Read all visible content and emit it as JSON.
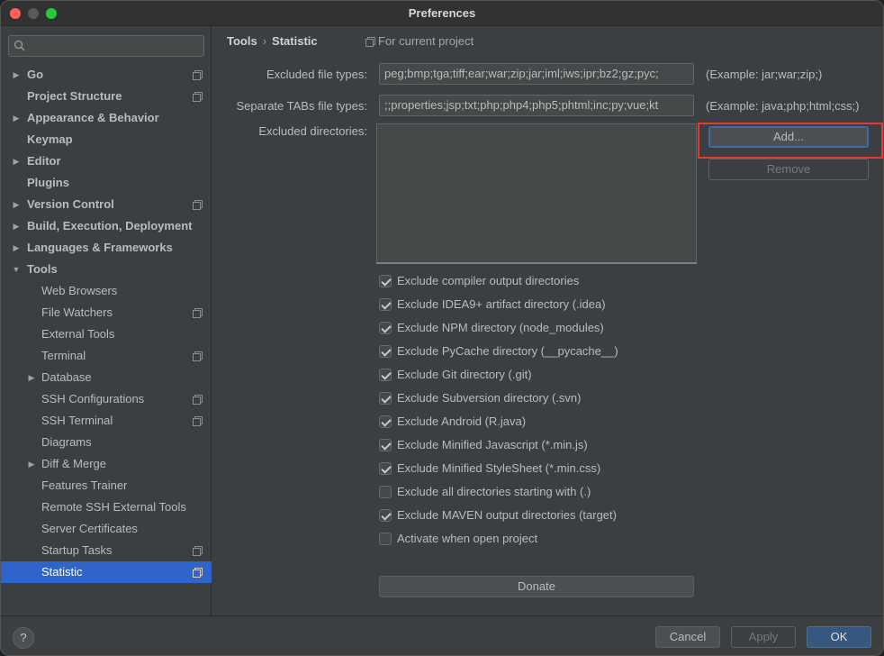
{
  "window": {
    "title": "Preferences"
  },
  "search": {
    "placeholder": ""
  },
  "sidebar": {
    "items": [
      {
        "label": "Go",
        "level": 0,
        "arrow": "right",
        "proj": true
      },
      {
        "label": "Project Structure",
        "level": 0,
        "arrow": "",
        "proj": true
      },
      {
        "label": "Appearance & Behavior",
        "level": 0,
        "arrow": "right",
        "proj": false
      },
      {
        "label": "Keymap",
        "level": 0,
        "arrow": "",
        "proj": false
      },
      {
        "label": "Editor",
        "level": 0,
        "arrow": "right",
        "proj": false
      },
      {
        "label": "Plugins",
        "level": 0,
        "arrow": "",
        "proj": false
      },
      {
        "label": "Version Control",
        "level": 0,
        "arrow": "right",
        "proj": true
      },
      {
        "label": "Build, Execution, Deployment",
        "level": 0,
        "arrow": "right",
        "proj": false
      },
      {
        "label": "Languages & Frameworks",
        "level": 0,
        "arrow": "right",
        "proj": false
      },
      {
        "label": "Tools",
        "level": 0,
        "arrow": "down",
        "proj": false
      },
      {
        "label": "Web Browsers",
        "level": 1,
        "arrow": "",
        "proj": false
      },
      {
        "label": "File Watchers",
        "level": 1,
        "arrow": "",
        "proj": true
      },
      {
        "label": "External Tools",
        "level": 1,
        "arrow": "",
        "proj": false
      },
      {
        "label": "Terminal",
        "level": 1,
        "arrow": "",
        "proj": true
      },
      {
        "label": "Database",
        "level": 1,
        "arrow": "right",
        "proj": false
      },
      {
        "label": "SSH Configurations",
        "level": 1,
        "arrow": "",
        "proj": true
      },
      {
        "label": "SSH Terminal",
        "level": 1,
        "arrow": "",
        "proj": true
      },
      {
        "label": "Diagrams",
        "level": 1,
        "arrow": "",
        "proj": false
      },
      {
        "label": "Diff & Merge",
        "level": 1,
        "arrow": "right",
        "proj": false
      },
      {
        "label": "Features Trainer",
        "level": 1,
        "arrow": "",
        "proj": false
      },
      {
        "label": "Remote SSH External Tools",
        "level": 1,
        "arrow": "",
        "proj": false
      },
      {
        "label": "Server Certificates",
        "level": 1,
        "arrow": "",
        "proj": false
      },
      {
        "label": "Startup Tasks",
        "level": 1,
        "arrow": "",
        "proj": true
      },
      {
        "label": "Statistic",
        "level": 1,
        "arrow": "",
        "proj": true,
        "selected": true
      }
    ]
  },
  "breadcrumb": {
    "parent": "Tools",
    "separator": "›",
    "current": "Statistic"
  },
  "scope": {
    "label": "For current project"
  },
  "form": {
    "excluded_types_label": "Excluded file types:",
    "excluded_types_value": "peg;bmp;tga;tiff;ear;war;zip;jar;iml;iws;ipr;bz2;gz;pyc;",
    "excluded_types_example": "(Example: jar;war;zip;)",
    "tabs_types_label": "Separate TABs file types:",
    "tabs_types_value": ";;properties;jsp;txt;php;php4;php5;phtml;inc;py;vue;kt",
    "tabs_types_example": "(Example: java;php;html;css;)",
    "excluded_dirs_label": "Excluded directories:",
    "add_label": "Add...",
    "remove_label": "Remove"
  },
  "checks": [
    {
      "label": "Exclude compiler output directories",
      "checked": true
    },
    {
      "label": "Exclude IDEA9+ artifact directory (.idea)",
      "checked": true
    },
    {
      "label": "Exclude NPM directory (node_modules)",
      "checked": true
    },
    {
      "label": "Exclude PyCache directory (__pycache__)",
      "checked": true
    },
    {
      "label": "Exclude Git directory (.git)",
      "checked": true
    },
    {
      "label": "Exclude Subversion directory (.svn)",
      "checked": true
    },
    {
      "label": "Exclude Android (R.java)",
      "checked": true
    },
    {
      "label": "Exclude Minified Javascript (*.min.js)",
      "checked": true
    },
    {
      "label": "Exclude Minified StyleSheet (*.min.css)",
      "checked": true
    },
    {
      "label": "Exclude all directories starting with (.)",
      "checked": false
    },
    {
      "label": "Exclude MAVEN output directories (target)",
      "checked": true
    },
    {
      "label": "Activate when open project",
      "checked": false
    }
  ],
  "donate_label": "Donate",
  "footer": {
    "help": "?",
    "cancel": "Cancel",
    "apply": "Apply",
    "ok": "OK"
  }
}
